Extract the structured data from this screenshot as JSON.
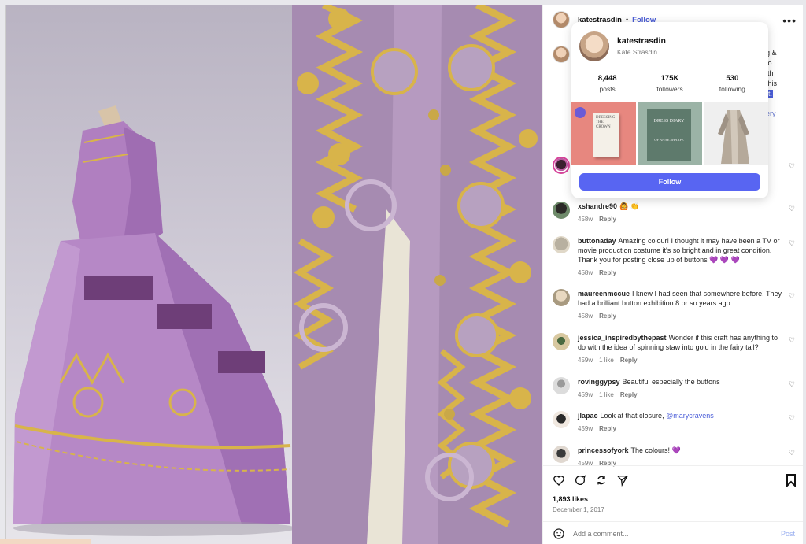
{
  "header": {
    "username": "katestrasdin",
    "separator": "•",
    "follow_label": "Follow",
    "more_icon": "ellipsis-icon"
  },
  "caption": {
    "snip_lines": [
      "g &",
      "to",
      "ith",
      "this"
    ],
    "highlight": "it.",
    "blue_text": "ery"
  },
  "hover_card": {
    "username": "katestrasdin",
    "full_name": "Kate Strasdin",
    "stats": [
      {
        "value": "8,448",
        "label": "posts"
      },
      {
        "value": "175K",
        "label": "followers"
      },
      {
        "value": "530",
        "label": "following"
      }
    ],
    "thumb1_title": "DRESSING THE CROWN",
    "thumb2_title": "DRESS DIARY",
    "thumb2_sub": "OF ANNE SHARPE",
    "follow_button": "Follow"
  },
  "comments": [
    {
      "user": "",
      "text": "",
      "time": "",
      "likes": "",
      "reply": ""
    },
    {
      "user": "xshandre90",
      "text": "🙆 👏",
      "time": "458w",
      "likes": "",
      "reply": "Reply"
    },
    {
      "user": "buttonaday",
      "text": "Amazing colour! I thought it may have been a TV or movie production costume it's so bright and in great condition. Thank you for posting close up of buttons 💜 💜 💜",
      "time": "458w",
      "likes": "",
      "reply": "Reply"
    },
    {
      "user": "maureenmccue",
      "text": "I knew I had seen that somewhere before! They had a brilliant button exhibition 8 or so years ago",
      "time": "458w",
      "likes": "",
      "reply": "Reply"
    },
    {
      "user": "jessica_inspiredbythepast",
      "text": "Wonder if this craft has anything to do with the idea of spinning staw into gold in the fairy tail?",
      "time": "459w",
      "likes": "1 like",
      "reply": "Reply"
    },
    {
      "user": "rovinggypsy",
      "text": "Beautiful especially the buttons",
      "time": "459w",
      "likes": "1 like",
      "reply": "Reply"
    },
    {
      "user": "jlapac",
      "text": "Look at that closure,",
      "mention": "@marycravens",
      "time": "459w",
      "likes": "",
      "reply": "Reply"
    },
    {
      "user": "princessofyork",
      "text": "The colours! 💜",
      "time": "459w",
      "likes": "",
      "reply": "Reply"
    }
  ],
  "actions": {
    "likes": "1,893 likes",
    "date": "December 1, 2017",
    "comment_placeholder": "Add a comment...",
    "post_label": "Post"
  },
  "colors": {
    "accent": "#5865f2",
    "link": "#4a5dd8",
    "dress_purple": "#a98ab0",
    "gold": "#d8b44a"
  }
}
